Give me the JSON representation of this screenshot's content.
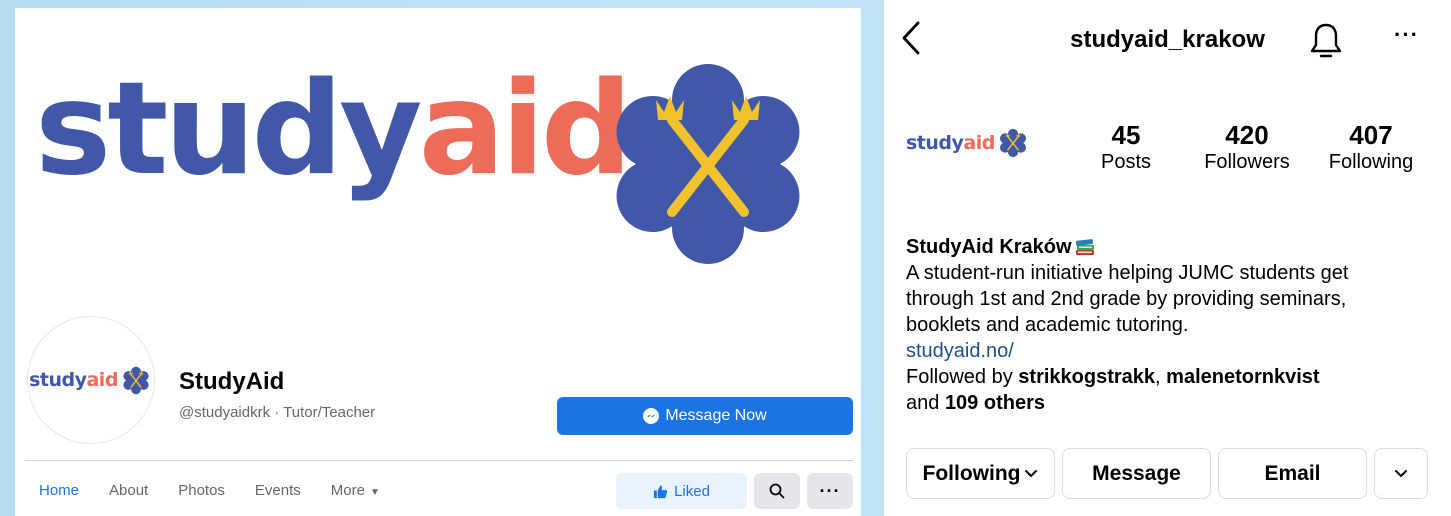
{
  "facebook": {
    "cover_logo": {
      "word_part1": "study",
      "word_part2": "aid"
    },
    "avatar_logo": {
      "word_part1": "study",
      "word_part2": "aid"
    },
    "page_name": "StudyAid",
    "handle_category": "@studyaidkrk · Tutor/Teacher",
    "message_button": "Message Now",
    "tabs": [
      {
        "label": "Home",
        "active": true
      },
      {
        "label": "About"
      },
      {
        "label": "Photos"
      },
      {
        "label": "Events"
      },
      {
        "label": "More"
      }
    ],
    "liked_button": "Liked",
    "more_button": "···",
    "colors": {
      "blue": "#4158a9",
      "orange": "#ec6b59",
      "gold": "#f2c12e",
      "fb_blue": "#1b74e4"
    }
  },
  "instagram": {
    "username": "studyaid_krakow",
    "more_icon": "···",
    "avatar_logo": {
      "word_part1": "study",
      "word_part2": "aid"
    },
    "stats": {
      "posts": {
        "value": "45",
        "label": "Posts"
      },
      "followers": {
        "value": "420",
        "label": "Followers"
      },
      "following": {
        "value": "407",
        "label": "Following"
      }
    },
    "bio": {
      "display_name": "StudyAid Kraków",
      "line1": "A student-run initiative helping JUMC students get",
      "line2": "through 1st and 2nd grade by providing seminars,",
      "line3": "booklets and academic tutoring.",
      "link": "studyaid.no/",
      "followed_by_prefix": "Followed by ",
      "follower1": "strikkogstrakk",
      "sep": ", ",
      "follower2": "malenetornkvist",
      "and_prefix": "and ",
      "others": "109 others"
    },
    "buttons": {
      "following": "Following",
      "message": "Message",
      "email": "Email"
    }
  }
}
